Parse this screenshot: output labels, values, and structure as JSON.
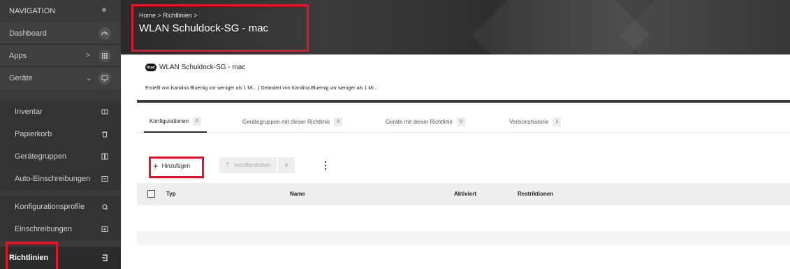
{
  "sidebar": {
    "header": "NAVIGATION",
    "items": [
      {
        "label": "Dashboard",
        "icon": "dashboard-icon"
      },
      {
        "label": "Apps",
        "icon": "grid-icon",
        "chevron": ">"
      },
      {
        "label": "Geräte",
        "icon": "devices-icon",
        "chevron": "⌄"
      },
      {
        "label": "Inventar",
        "icon": "inventory-icon"
      },
      {
        "label": "Papierkorb",
        "icon": "trash-icon"
      },
      {
        "label": "Gerätegruppen",
        "icon": "device-groups-icon"
      },
      {
        "label": "Auto-Einschreibungen",
        "icon": "auto-enroll-icon"
      },
      {
        "label": "Konfigurationsprofile",
        "icon": "config-profile-icon"
      },
      {
        "label": "Einschreibungen",
        "icon": "enrollment-icon"
      },
      {
        "label": "Richtlinien",
        "icon": "policy-icon"
      }
    ]
  },
  "header": {
    "breadcrumb": "Home > Richtlinien >",
    "title": "WLAN Schuldock-SG - mac"
  },
  "info": {
    "logo_text": "mac",
    "title": "WLAN Schuldock-SG - mac",
    "meta": "Erstellt von Karolina.Bluemig vor weniger als 1 Mi... | Geändert von Karolina.Bluemig vor weniger als 1 Mi..."
  },
  "tabs": [
    {
      "label": "Konfigurationen",
      "count": "0"
    },
    {
      "label": "Gerätegruppen mit dieser Richtlinie",
      "count": "0"
    },
    {
      "label": "Geräte mit dieser Richtlinie",
      "count": "0"
    },
    {
      "label": "Versionshistorie",
      "count": "1"
    }
  ],
  "toolbar": {
    "add_label": "Hinzufügen",
    "publish_label": "Veröffentlichen",
    "more": "⋮"
  },
  "table": {
    "columns": [
      "Typ",
      "Name",
      "Aktiviert",
      "Restriktionen"
    ]
  },
  "colors": {
    "highlight": "#e0162b",
    "sidebar_bg": "#3a3a3a"
  }
}
